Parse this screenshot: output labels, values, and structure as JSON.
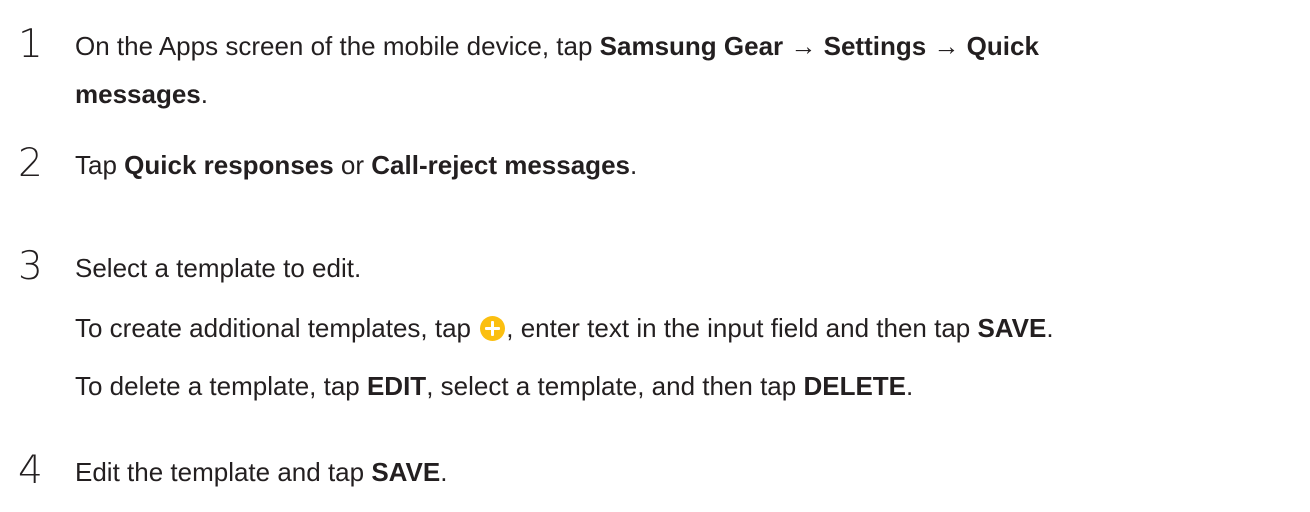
{
  "steps": [
    {
      "number": "1",
      "line1": {
        "t1": "On the Apps screen of the mobile device, tap ",
        "b1": "Samsung Gear",
        "t2": " → ",
        "b2": "Settings",
        "t3": " → ",
        "b3": "Quick"
      },
      "line2": {
        "b1": "messages",
        "t1": "."
      }
    },
    {
      "number": "2",
      "line1": {
        "t1": "Tap ",
        "b1": "Quick responses",
        "t2": " or ",
        "b2": "Call-reject messages",
        "t3": "."
      }
    },
    {
      "number": "3",
      "line1": {
        "t1": "Select a template to edit."
      },
      "line2": {
        "t1": "To create additional templates, tap ",
        "icon": "plus-circle-icon",
        "t2": ", enter text in the input field and then tap ",
        "b1": "SAVE",
        "t3": "."
      },
      "line3": {
        "t1": "To delete a template, tap ",
        "b1": "EDIT",
        "t2": ", select a template, and then tap ",
        "b2": "DELETE",
        "t3": "."
      }
    },
    {
      "number": "4",
      "line1": {
        "t1": "Edit the template and tap ",
        "b1": "SAVE",
        "t2": "."
      }
    }
  ],
  "colors": {
    "text": "#231f20",
    "icon_accent": "#fbbf10"
  }
}
